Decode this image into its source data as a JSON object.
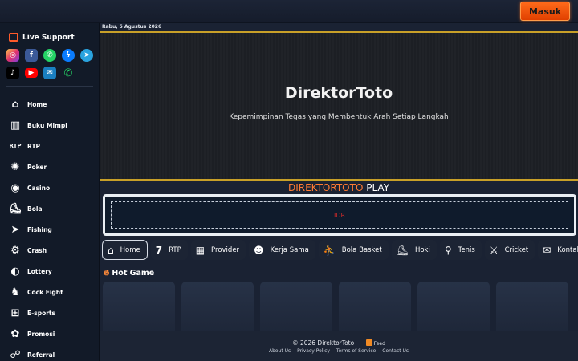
{
  "header": {
    "login_label": "Masuk"
  },
  "sidebar": {
    "live_support_label": "Live Support",
    "social_row_1": [
      "instagram-icon",
      "facebook-icon",
      "whatsapp-icon",
      "messenger-icon",
      "telegram-icon"
    ],
    "social_row_2": [
      "tiktok-icon",
      "youtube-icon",
      "email-icon",
      "phone-icon"
    ],
    "items": [
      {
        "label": "Home",
        "icon": "home-icon"
      },
      {
        "label": "Buku Mimpi",
        "icon": "book-icon"
      },
      {
        "label": "RTP",
        "icon": "rtp-icon"
      },
      {
        "label": "Poker",
        "icon": "poker-chip-icon"
      },
      {
        "label": "Casino",
        "icon": "casino-chip-icon"
      },
      {
        "label": "Bola",
        "icon": "shoe-icon"
      },
      {
        "label": "Fishing",
        "icon": "fish-icon"
      },
      {
        "label": "Crash",
        "icon": "crash-icon"
      },
      {
        "label": "Lottery",
        "icon": "lottery-icon"
      },
      {
        "label": "Cock Fight",
        "icon": "rooster-icon"
      },
      {
        "label": "E-sports",
        "icon": "gamepad-icon"
      },
      {
        "label": "Promosi",
        "icon": "promo-icon"
      },
      {
        "label": "Referral",
        "icon": "referral-icon"
      }
    ]
  },
  "main": {
    "date": "Rabu, 5 Agustus 2026",
    "hero_title": "DirektorToto",
    "hero_subtitle": "Kepemimpinan Tegas yang Membentuk Arah Setiap Langkah",
    "play_title_part1": "DIREKTORTOTO",
    "play_title_part2": " PLAY",
    "idr_label": "IDR",
    "tabs": [
      {
        "label": "Home",
        "icon": "home-icon"
      },
      {
        "label": "RTP",
        "icon": "seven-icon"
      },
      {
        "label": "Provider",
        "icon": "provider-icon"
      },
      {
        "label": "Kerja Sama",
        "icon": "handshake-icon"
      },
      {
        "label": "Bola Basket",
        "icon": "basketball-player-icon"
      },
      {
        "label": "Hoki",
        "icon": "hockey-icon"
      },
      {
        "label": "Tenis",
        "icon": "tennis-racket-icon"
      },
      {
        "label": "Cricket",
        "icon": "cricket-bat-icon"
      },
      {
        "label": "Kontak",
        "icon": "envelope-icon"
      }
    ],
    "hot_game_label": "Hot Game"
  },
  "footer": {
    "copyright": "© 2026  DirektorToto",
    "feed_label": "Feed",
    "links": [
      "About Us",
      "Privacy Policy",
      "Terms of Service",
      "Contact Us"
    ]
  },
  "colors": {
    "accent": "#ff6a1a",
    "gold_border": "#c8a028",
    "sidebar_bg": "#121a28",
    "idr_text": "#cc2a2a"
  }
}
